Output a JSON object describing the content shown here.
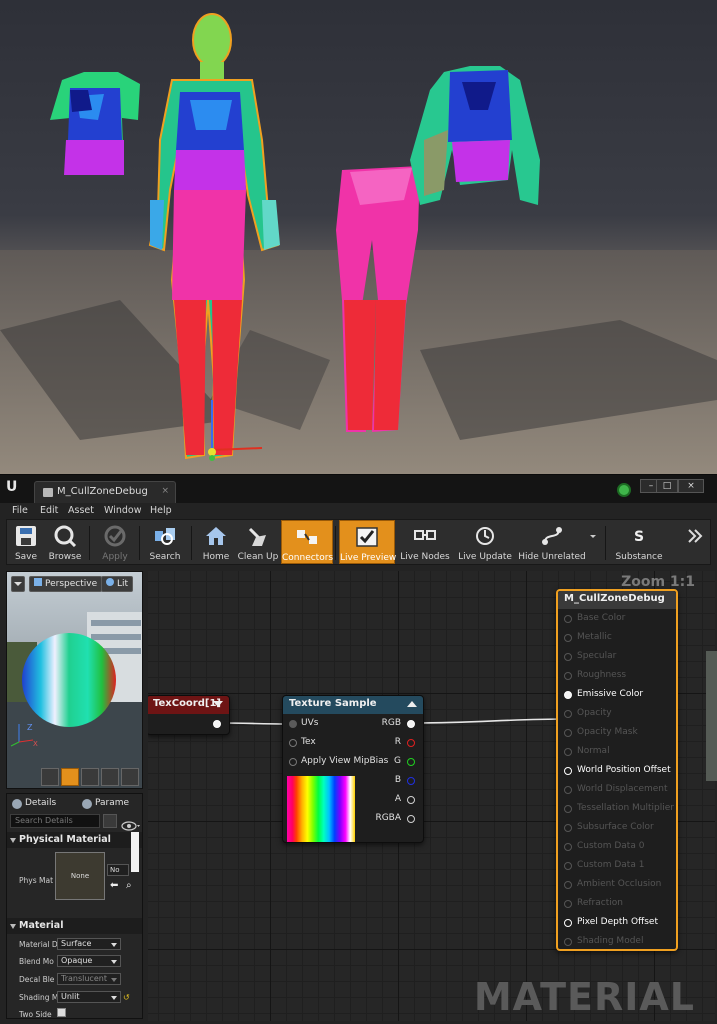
{
  "window": {
    "tab_title": "M_CullZoneDebug",
    "tab_close": "×"
  },
  "window_controls": {
    "minimize": "–",
    "maximize": "□",
    "close": "×"
  },
  "menu": [
    "File",
    "Edit",
    "Asset",
    "Window",
    "Help"
  ],
  "toolbar": [
    {
      "label": "Save",
      "icon": "save-icon"
    },
    {
      "label": "Browse",
      "icon": "browse-icon"
    },
    {
      "label": "Apply",
      "icon": "apply-icon",
      "disabled": true
    },
    {
      "label": "Search",
      "icon": "search-icon"
    },
    {
      "label": "Home",
      "icon": "home-icon"
    },
    {
      "label": "Clean Up",
      "icon": "clean-up-icon"
    },
    {
      "label": "Connectors",
      "icon": "connectors-icon",
      "active": true
    },
    {
      "label": "Live Preview",
      "icon": "live-preview-icon",
      "active": true
    },
    {
      "label": "Live Nodes",
      "icon": "live-nodes-icon"
    },
    {
      "label": "Live Update",
      "icon": "live-update-icon"
    },
    {
      "label": "Hide Unrelated",
      "icon": "hide-unrelated-icon"
    },
    {
      "label": "Substance",
      "icon": "substance-icon"
    }
  ],
  "viewport": {
    "perspective_label": "Perspective",
    "lit_label": "Lit",
    "axis_z": "Z",
    "axis_x": "X"
  },
  "details": {
    "tabs": [
      "Details",
      "Parame"
    ],
    "search_placeholder": "Search Details",
    "physical_material_section": "Physical Material",
    "phys_mat_label": "Phys Mat",
    "phys_mat_value": "None",
    "phys_mat_combo": "No",
    "material_section": "Material",
    "rows": [
      {
        "label": "Material D",
        "value": "Surface"
      },
      {
        "label": "Blend Mo",
        "value": "Opaque"
      },
      {
        "label": "Decal Ble",
        "value": "Translucent",
        "dim": true
      },
      {
        "label": "Shading M",
        "value": "Unlit"
      },
      {
        "label": "Two Side",
        "value": ""
      }
    ]
  },
  "graph": {
    "zoom": "Zoom 1:1",
    "watermark": "MATERIAL",
    "texcoord_node": {
      "title": "TexCoord[1]"
    },
    "texture_node": {
      "title": "Texture Sample",
      "inputs": [
        "UVs",
        "Tex",
        "Apply View MipBias"
      ],
      "outputs": [
        "RGB",
        "R",
        "G",
        "B",
        "A",
        "RGBA"
      ]
    },
    "result_node": {
      "title": "M_CullZoneDebug",
      "pins": [
        {
          "label": "Base Color",
          "active": false
        },
        {
          "label": "Metallic",
          "active": false
        },
        {
          "label": "Specular",
          "active": false
        },
        {
          "label": "Roughness",
          "active": false
        },
        {
          "label": "Emissive Color",
          "active": true,
          "connected": true
        },
        {
          "label": "Opacity",
          "active": false
        },
        {
          "label": "Opacity Mask",
          "active": false
        },
        {
          "label": "Normal",
          "active": false
        },
        {
          "label": "World Position Offset",
          "active": true
        },
        {
          "label": "World Displacement",
          "active": false
        },
        {
          "label": "Tessellation Multiplier",
          "active": false
        },
        {
          "label": "Subsurface Color",
          "active": false
        },
        {
          "label": "Custom Data 0",
          "active": false
        },
        {
          "label": "Custom Data 1",
          "active": false
        },
        {
          "label": "Ambient Occlusion",
          "active": false
        },
        {
          "label": "Refraction",
          "active": false
        },
        {
          "label": "Pixel Depth Offset",
          "active": true
        },
        {
          "label": "Shading Model",
          "active": false
        }
      ]
    }
  },
  "colors": {
    "accent_orange": "#e3901c",
    "texture_header": "#244a5e",
    "texcoord_header": "#6e1414",
    "result_header": "#3a3a3a",
    "selection_border": "#f0a020"
  }
}
